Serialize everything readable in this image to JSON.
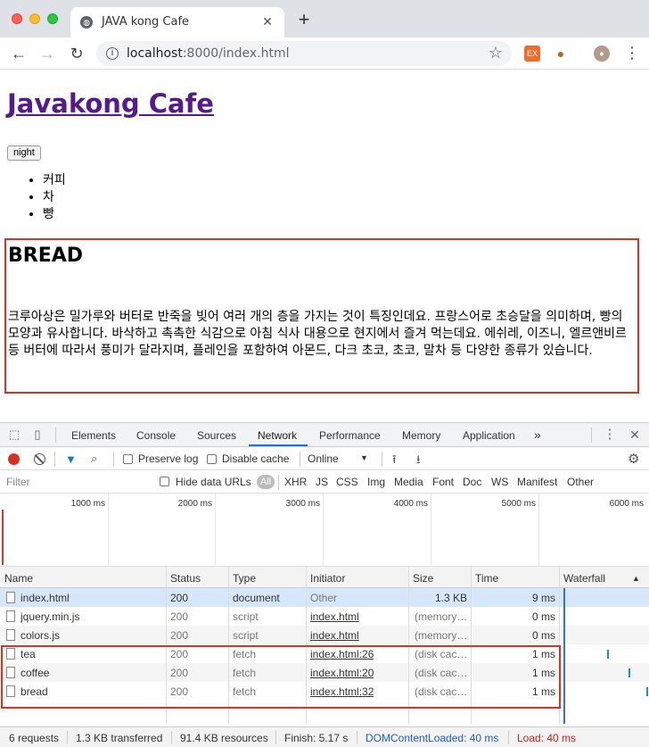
{
  "browser": {
    "tab_title": "JAVA kong Cafe",
    "url_host": "localhost",
    "url_rest": ":8000/index.html"
  },
  "page": {
    "title": "Javakong Cafe",
    "night_button": "night",
    "menu": [
      "커피",
      "차",
      "빵"
    ],
    "article": {
      "heading": "BREAD",
      "body": "크루아상은 밀가루와 버터로 반죽을 빚어 여러 개의 층을 가지는 것이 특징인데요. 프랑스어로 초승달을 의미하며, 빵의 모양과 유사합니다. 바삭하고 촉촉한 식감으로 아침 식사 대용으로 현지에서 즐겨 먹는데요. 에쉬레, 이즈니, 엘르앤비르 등 버터에 따라서 풍미가 달라지며, 플레인을 포함하여 아몬드, 다크 초코, 초코, 말차 등 다양한 종류가 있습니다."
    }
  },
  "devtools": {
    "tabs": [
      "Elements",
      "Console",
      "Sources",
      "Network",
      "Performance",
      "Memory",
      "Application"
    ],
    "active_tab": "Network",
    "more": "»",
    "toolbar": {
      "preserve_log": "Preserve log",
      "disable_cache": "Disable cache",
      "throttle": "Online"
    },
    "filter": {
      "placeholder": "Filter",
      "hide_data_urls": "Hide data URLs",
      "types": [
        "All",
        "XHR",
        "JS",
        "CSS",
        "Img",
        "Media",
        "Font",
        "Doc",
        "WS",
        "Manifest",
        "Other"
      ]
    },
    "timeline_labels": [
      "1000 ms",
      "2000 ms",
      "3000 ms",
      "4000 ms",
      "5000 ms",
      "6000 ms"
    ],
    "columns": [
      "Name",
      "Status",
      "Type",
      "Initiator",
      "Size",
      "Time",
      "Waterfall"
    ],
    "rows": [
      {
        "name": "index.html",
        "status": "200",
        "type": "document",
        "initiator": "Other",
        "size": "1.3 KB",
        "time": "9 ms"
      },
      {
        "name": "jquery.min.js",
        "status": "200",
        "type": "script",
        "initiator": "index.html",
        "size": "(memory…",
        "time": "0 ms"
      },
      {
        "name": "colors.js",
        "status": "200",
        "type": "script",
        "initiator": "index.html",
        "size": "(memory…",
        "time": "0 ms"
      },
      {
        "name": "tea",
        "status": "200",
        "type": "fetch",
        "initiator": "index.html:26",
        "size": "(disk cac…",
        "time": "1 ms"
      },
      {
        "name": "coffee",
        "status": "200",
        "type": "fetch",
        "initiator": "index.html:20",
        "size": "(disk cac…",
        "time": "1 ms"
      },
      {
        "name": "bread",
        "status": "200",
        "type": "fetch",
        "initiator": "index.html:32",
        "size": "(disk cac…",
        "time": "1 ms"
      }
    ],
    "status_bar": {
      "requests": "6 requests",
      "transferred": "1.3 KB transferred",
      "resources": "91.4 KB resources",
      "finish": "Finish: 5.17 s",
      "dom_content_loaded": "DOMContentLoaded: 40 ms",
      "load": "Load: 40 ms"
    }
  },
  "colors": {
    "link_visited": "#551a8b",
    "highlight_border": "#e0301e",
    "dcl_blue": "#1a5fd6",
    "load_red": "#c5221f"
  }
}
